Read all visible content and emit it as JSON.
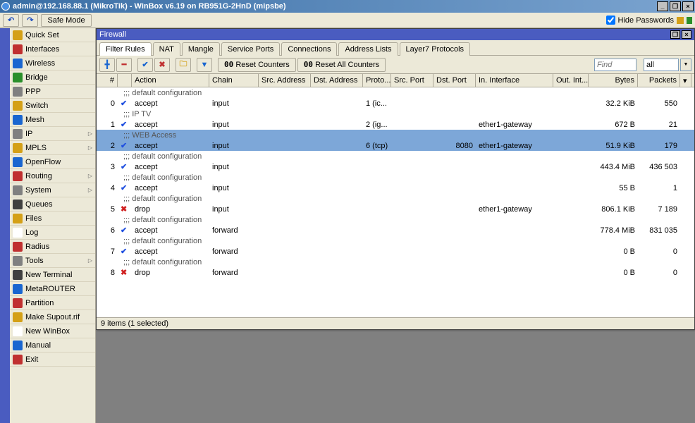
{
  "title": "admin@192.168.88.1 (MikroTik) - WinBox v6.19 on RB951G-2HnD (mipsbe)",
  "toolbar": {
    "safe_mode": "Safe Mode",
    "hide_passwords": "Hide Passwords"
  },
  "sidebar": {
    "items": [
      {
        "label": "Quick Set",
        "sub": false
      },
      {
        "label": "Interfaces",
        "sub": false
      },
      {
        "label": "Wireless",
        "sub": false
      },
      {
        "label": "Bridge",
        "sub": false
      },
      {
        "label": "PPP",
        "sub": false
      },
      {
        "label": "Switch",
        "sub": false
      },
      {
        "label": "Mesh",
        "sub": false
      },
      {
        "label": "IP",
        "sub": true
      },
      {
        "label": "MPLS",
        "sub": true
      },
      {
        "label": "OpenFlow",
        "sub": false
      },
      {
        "label": "Routing",
        "sub": true
      },
      {
        "label": "System",
        "sub": true
      },
      {
        "label": "Queues",
        "sub": false
      },
      {
        "label": "Files",
        "sub": false
      },
      {
        "label": "Log",
        "sub": false
      },
      {
        "label": "Radius",
        "sub": false
      },
      {
        "label": "Tools",
        "sub": true
      },
      {
        "label": "New Terminal",
        "sub": false
      },
      {
        "label": "MetaROUTER",
        "sub": false
      },
      {
        "label": "Partition",
        "sub": false
      },
      {
        "label": "Make Supout.rif",
        "sub": false
      },
      {
        "label": "New WinBox",
        "sub": false
      },
      {
        "label": "Manual",
        "sub": false
      },
      {
        "label": "Exit",
        "sub": false
      }
    ]
  },
  "firewall": {
    "title": "Firewall",
    "tabs": [
      "Filter Rules",
      "NAT",
      "Mangle",
      "Service Ports",
      "Connections",
      "Address Lists",
      "Layer7 Protocols"
    ],
    "active_tab": 0,
    "buttons": {
      "reset": "Reset Counters",
      "reset_all": "Reset All Counters",
      "counter_prefix": "00"
    },
    "find_placeholder": "Find",
    "filter_value": "all",
    "columns": [
      "#",
      "",
      "Action",
      "Chain",
      "Src. Address",
      "Dst. Address",
      "Proto...",
      "Src. Port",
      "Dst. Port",
      "In. Interface",
      "Out. Int...",
      "Bytes",
      "Packets"
    ],
    "rows": [
      {
        "type": "comment",
        "text": ";;; default configuration"
      },
      {
        "n": "0",
        "action": "accept",
        "chain": "input",
        "proto": "1 (ic...",
        "bytes": "32.2 KiB",
        "packets": "550"
      },
      {
        "type": "comment",
        "text": ";;; IP TV"
      },
      {
        "n": "1",
        "action": "accept",
        "chain": "input",
        "proto": "2 (ig...",
        "inif": "ether1-gateway",
        "bytes": "672 B",
        "packets": "21"
      },
      {
        "type": "comment",
        "text": ";;; WEB Access",
        "selected": true
      },
      {
        "n": "2",
        "action": "accept",
        "chain": "input",
        "proto": "6 (tcp)",
        "dstport": "8080",
        "inif": "ether1-gateway",
        "bytes": "51.9 KiB",
        "packets": "179",
        "selected": true
      },
      {
        "type": "comment",
        "text": ";;; default configuration"
      },
      {
        "n": "3",
        "action": "accept",
        "chain": "input",
        "bytes": "443.4 MiB",
        "packets": "436 503"
      },
      {
        "type": "comment",
        "text": ";;; default configuration"
      },
      {
        "n": "4",
        "action": "accept",
        "chain": "input",
        "bytes": "55 B",
        "packets": "1"
      },
      {
        "type": "comment",
        "text": ";;; default configuration"
      },
      {
        "n": "5",
        "action": "drop",
        "chain": "input",
        "inif": "ether1-gateway",
        "bytes": "806.1 KiB",
        "packets": "7 189"
      },
      {
        "type": "comment",
        "text": ";;; default configuration"
      },
      {
        "n": "6",
        "action": "accept",
        "chain": "forward",
        "bytes": "778.4 MiB",
        "packets": "831 035"
      },
      {
        "type": "comment",
        "text": ";;; default configuration"
      },
      {
        "n": "7",
        "action": "accept",
        "chain": "forward",
        "bytes": "0 B",
        "packets": "0"
      },
      {
        "type": "comment",
        "text": ";;; default configuration"
      },
      {
        "n": "8",
        "action": "drop",
        "chain": "forward",
        "bytes": "0 B",
        "packets": "0"
      }
    ],
    "status": "9 items (1 selected)"
  },
  "colors": {
    "accept": "#2050e0",
    "drop": "#d02020"
  }
}
